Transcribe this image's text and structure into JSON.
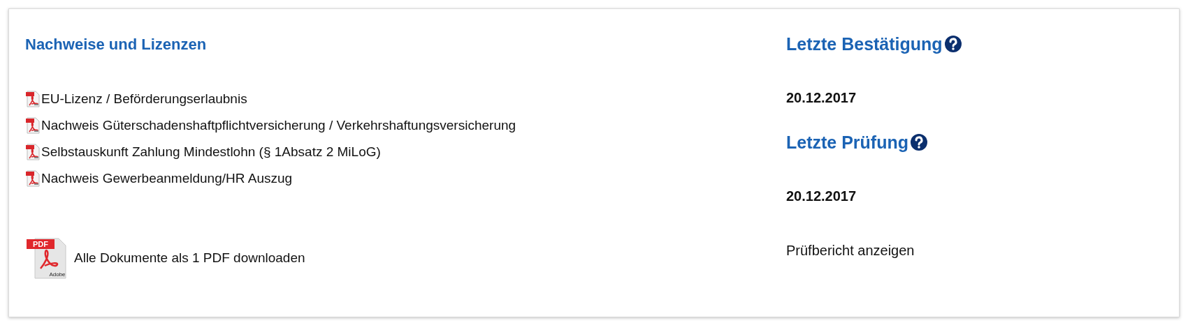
{
  "documents": {
    "title": "Nachweise und Lizenzen",
    "items": [
      {
        "label": "EU-Lizenz / Beförderungserlaubnis"
      },
      {
        "label": "Nachweis Güterschadenshaftpflichtversicherung / Verkehrshaftungsversicherung"
      },
      {
        "label": "Selbstauskunft Zahlung Mindestlohn (§ 1Absatz 2 MiLoG)"
      },
      {
        "label": "Nachweis Gewerbeanmeldung/HR Auszug"
      }
    ],
    "download_all": {
      "label": "Alle Dokumente als 1 PDF downloaden",
      "icon_badge": "PDF",
      "icon_brand": "Adobe"
    }
  },
  "status": {
    "sections": [
      {
        "title": "Letzte Bestätigung",
        "date": "20.12.2017"
      },
      {
        "title": "Letzte Prüfung",
        "date": "20.12.2017",
        "link": "Prüfbericht anzeigen"
      }
    ]
  }
}
